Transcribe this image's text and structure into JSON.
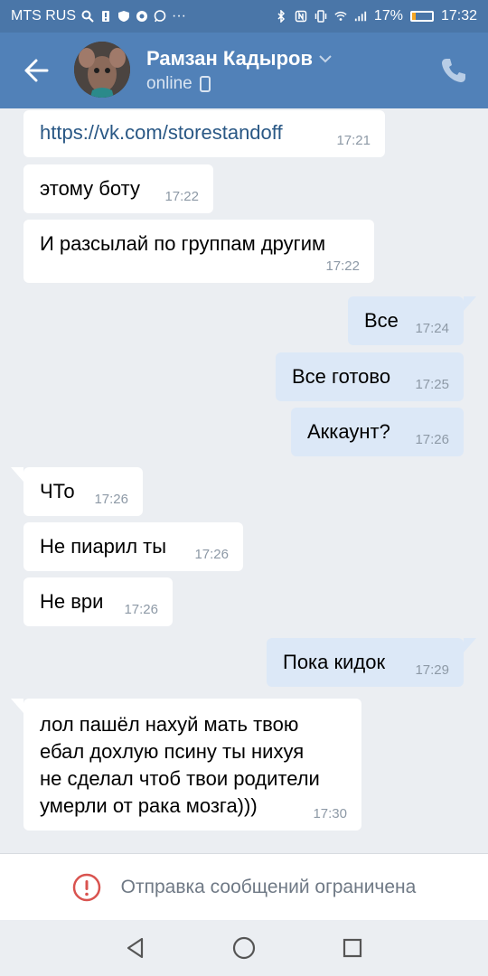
{
  "status_bar": {
    "carrier": "MTS RUS",
    "battery": "17%",
    "battery_level": 0.17,
    "time": "17:32"
  },
  "header": {
    "contact_name": "Рамзан Кадыров",
    "contact_status": "online"
  },
  "messages": [
    {
      "dir": "in",
      "text": "https://vk.com/storestandoff",
      "time": "17:21"
    },
    {
      "dir": "in",
      "text": "этому боту",
      "time": "17:22"
    },
    {
      "dir": "in",
      "text": "И разсылай по группам другим",
      "time": "17:22"
    },
    {
      "dir": "out",
      "text": "Все",
      "time": "17:24"
    },
    {
      "dir": "out",
      "text": "Все готово",
      "time": "17:25"
    },
    {
      "dir": "out",
      "text": "Аккаунт?",
      "time": "17:26"
    },
    {
      "dir": "in",
      "text": "ЧТо",
      "time": "17:26"
    },
    {
      "dir": "in",
      "text": "Не пиарил ты",
      "time": "17:26"
    },
    {
      "dir": "in",
      "text": "Не ври",
      "time": "17:26"
    },
    {
      "dir": "out",
      "text": "Пока кидок",
      "time": "17:29"
    },
    {
      "dir": "in",
      "text_lines": [
        "лол пашёл нахуй мать твою",
        "ебал дохлую псину ты нихуя",
        "не сделал чтоб твои родители",
        "умерли от рака мозга)))"
      ],
      "time": "17:30"
    }
  ],
  "banner": {
    "text": "Отправка сообщений ограничена"
  },
  "colors": {
    "header": "#5181b8",
    "status_bar": "#4a76a8",
    "outgoing_bubble": "#dce8f7",
    "incoming_bubble": "#ffffff",
    "link": "#2a5885",
    "alert": "#d9534f"
  },
  "icons": {
    "back": "arrow-left-icon",
    "call": "phone-icon",
    "status_device": "mobile-icon",
    "banner": "alert-circle-icon",
    "nav": [
      "back-triangle-icon",
      "home-circle-icon",
      "recents-square-icon"
    ]
  }
}
